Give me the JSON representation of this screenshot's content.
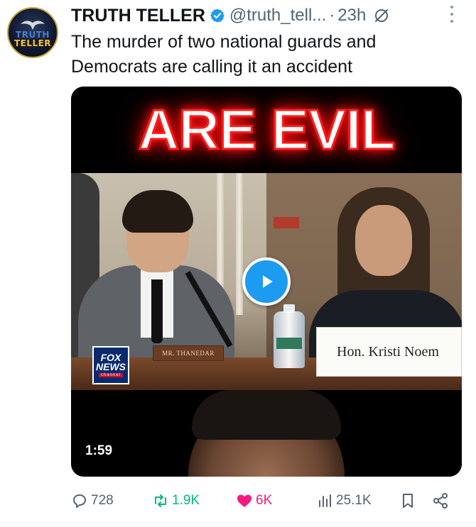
{
  "author": {
    "display_name": "TRUTH TELLER",
    "handle": "@truth_tell...",
    "separator": "·",
    "time": "23h",
    "avatar_text": [
      "TRUTH",
      "TELLER"
    ],
    "verified": true
  },
  "post": {
    "text": "The murder of two national guards and Democrats are calling it an accident"
  },
  "media": {
    "headline": "ARE EVIL",
    "nameplate_left": "MR. THANEDAR",
    "nameplate_right": "Hon. Kristi Noem",
    "network_logo": [
      "FOX",
      "NEWS",
      "channel"
    ],
    "duration": "1:59",
    "play_icon": "play-icon"
  },
  "actions": {
    "replies": "728",
    "reposts": "1.9K",
    "likes": "6K",
    "views": "25.1K"
  },
  "colors": {
    "accent": "#1d9bf0",
    "repost": "#00ba7c",
    "like": "#f91880",
    "secondary_text": "#536471",
    "headline_glow": "#ff1a1a"
  }
}
